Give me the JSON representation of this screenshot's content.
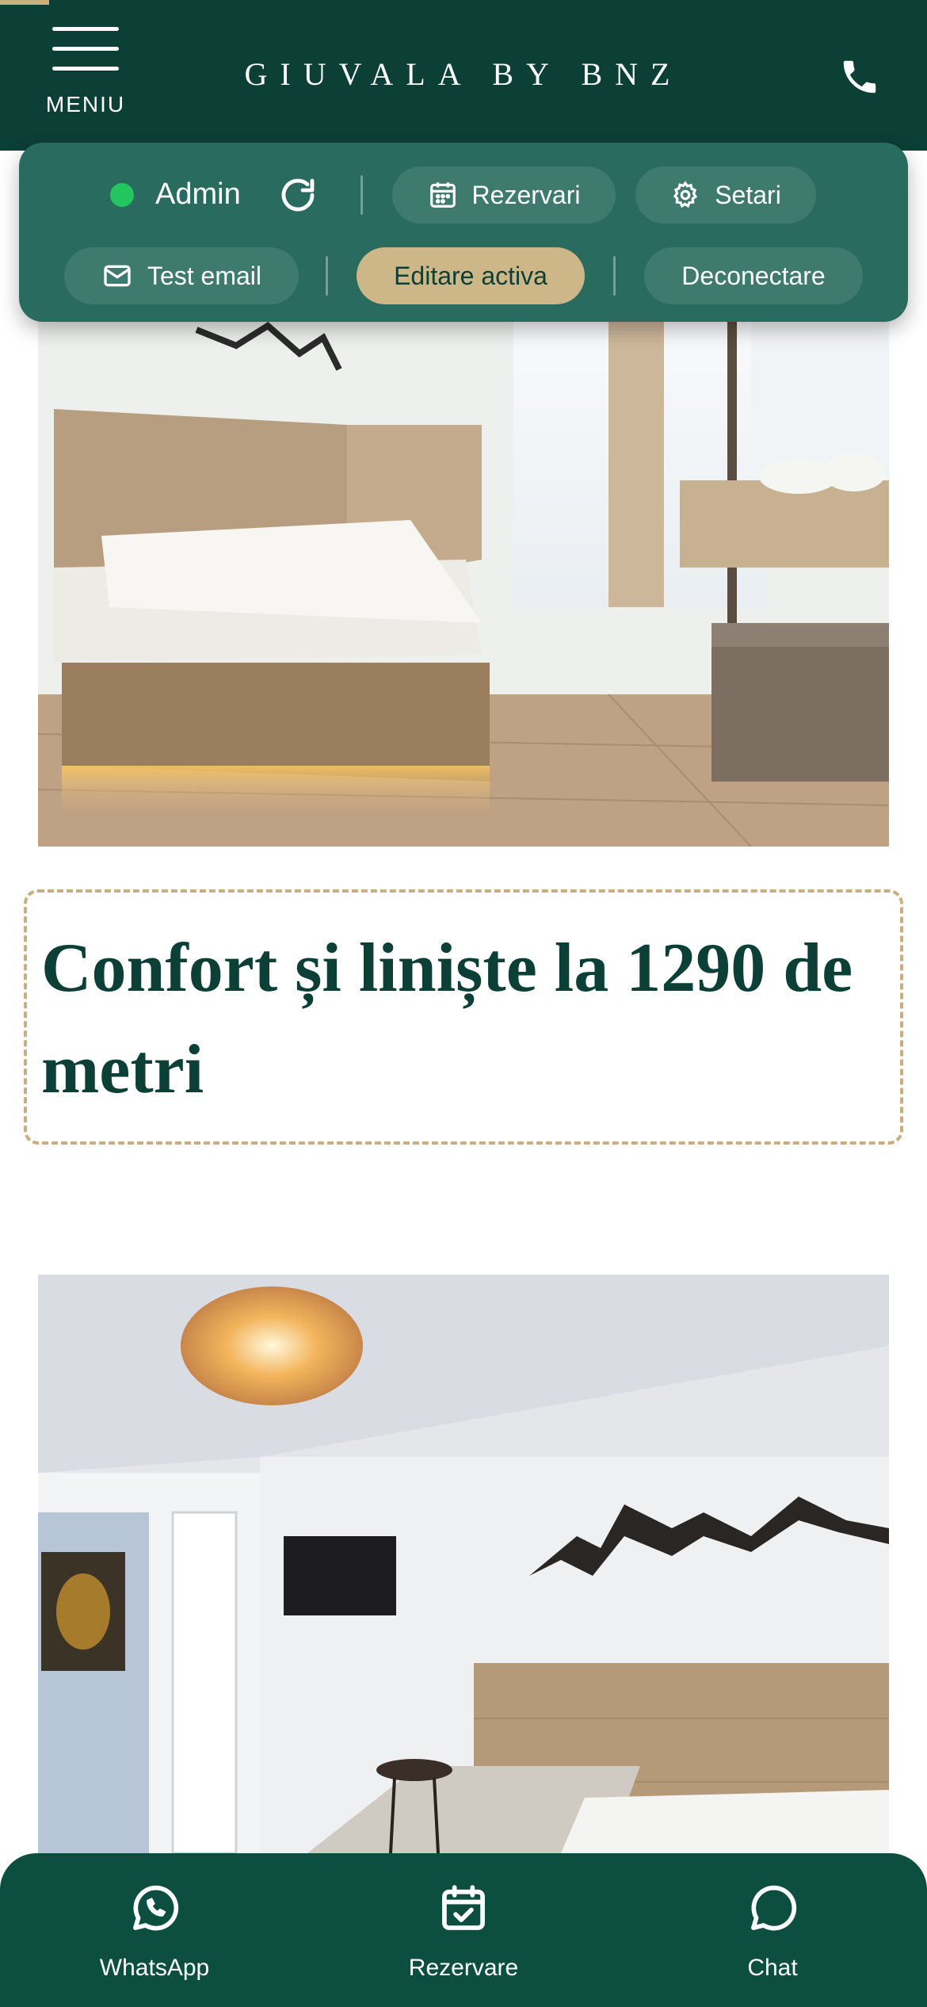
{
  "header": {
    "menu_label": "MENIU",
    "brand": "GIUVALA BY BNZ",
    "phone_icon": "phone-icon",
    "colors": {
      "background": "#0c3f36",
      "accent": "#c8ae82"
    }
  },
  "admin_bar": {
    "status_color": "#22c55e",
    "user_label": "Admin",
    "refresh_icon": "refresh-icon",
    "buttons": {
      "reservations": "Rezervari",
      "settings": "Setari",
      "test_email": "Test email",
      "edit_mode": "Editare activa",
      "logout": "Deconectare"
    }
  },
  "main": {
    "heading": "Confort și liniște la 1290 de metri",
    "photos": [
      "room-photo-bed",
      "room-photo-mountain-wall"
    ]
  },
  "bottom_nav": {
    "items": [
      {
        "label": "WhatsApp",
        "icon": "whatsapp-icon"
      },
      {
        "label": "Rezervare",
        "icon": "calendar-check-icon"
      },
      {
        "label": "Chat",
        "icon": "chat-bubble-icon"
      }
    ]
  }
}
